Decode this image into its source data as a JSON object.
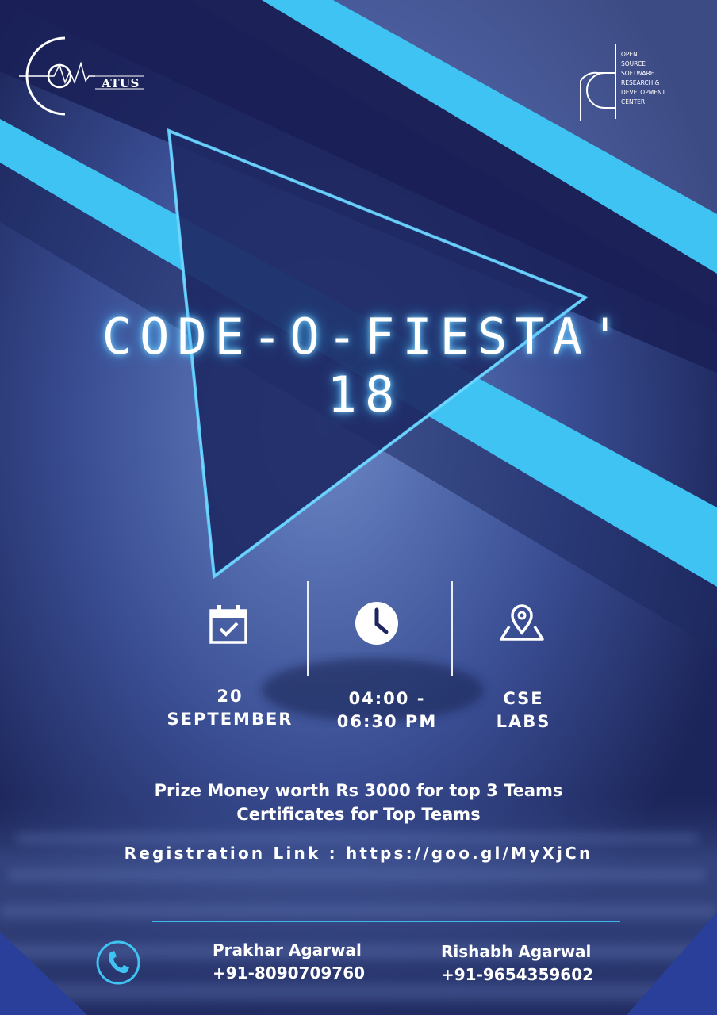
{
  "logos": {
    "left_text": "ATUS",
    "right_lines": [
      "OPEN",
      "SOURCE",
      "SOFTWARE",
      "RESEARCH &",
      "DEVELOPMENT",
      "CENTER"
    ]
  },
  "title": "CODE-O-FIESTA' 18",
  "info": {
    "date": {
      "line1": "20",
      "line2": "SEPTEMBER",
      "icon": "calendar-check-icon"
    },
    "time": {
      "line1": "04:00 -",
      "line2": "06:30 PM",
      "icon": "clock-icon"
    },
    "venue": {
      "line1": "CSE",
      "line2": "LABS",
      "icon": "map-pin-icon"
    }
  },
  "prize": {
    "line1": "Prize Money worth Rs 3000 for top 3 Teams",
    "line2": "Certificates for Top Teams"
  },
  "registration": "Registration Link : https://goo.gl/MyXjCn",
  "contacts": [
    {
      "name": "Prakhar Agarwal",
      "phone": "+91-8090709760"
    },
    {
      "name": "Rishabh Agarwal",
      "phone": "+91-9654359602"
    }
  ],
  "colors": {
    "background": "#1b2458",
    "accent": "#3fc3f2",
    "glow": "#7fd6ff"
  }
}
